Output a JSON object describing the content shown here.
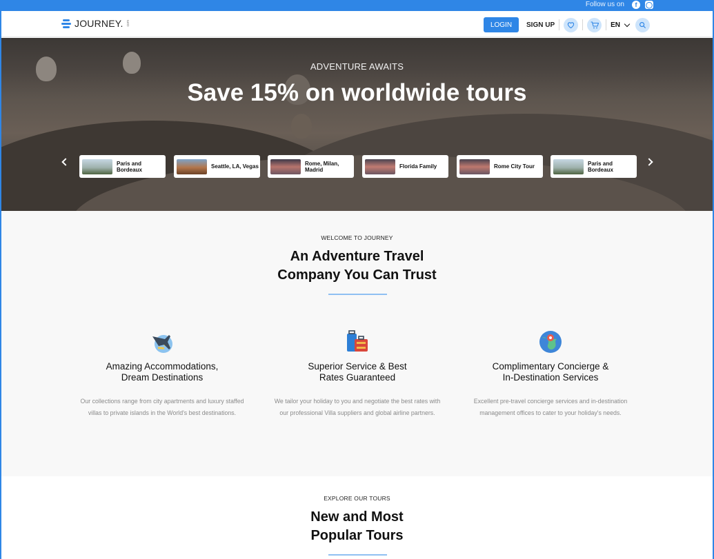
{
  "topbar": {
    "follow_text": "Follow us on",
    "social": [
      "facebook-icon",
      "instagram-icon"
    ]
  },
  "header": {
    "logo_text": "JOURNEY.",
    "logo_sub": "com",
    "login_label": "LOGIN",
    "signup_label": "SIGN UP",
    "language": "EN",
    "icons": [
      "heart-icon",
      "cart-icon",
      "search-icon"
    ]
  },
  "hero": {
    "kicker": "ADVENTURE AWAITS",
    "title": "Save 15% on worldwide tours",
    "cards": [
      {
        "label": "Paris and Bordeaux"
      },
      {
        "label": "Seattle, LA, Vegas"
      },
      {
        "label": "Rome, Milan, Madrid"
      },
      {
        "label": "Florida Family"
      },
      {
        "label": "Rome City Tour"
      },
      {
        "label": "Paris and Bordeaux"
      }
    ]
  },
  "welcome": {
    "kicker": "WELCOME TO JOURNEY",
    "title_line1": "An Adventure Travel",
    "title_line2": "Company You Can Trust",
    "features": [
      {
        "icon": "plane-globe-icon",
        "title_line1": "Amazing Accommodations,",
        "title_line2": "Dream Destinations",
        "desc": "Our collections range from city apartments and luxury staffed villas to private islands in the World's best destinations."
      },
      {
        "icon": "luggage-icon",
        "title_line1": "Superior Service & Best",
        "title_line2": "Rates Guaranteed",
        "desc": "We tailor your holiday to you and negotiate the best rates with our professional Villa suppliers and global airline partners."
      },
      {
        "icon": "globe-pin-icon",
        "title_line1": "Complimentary Concierge &",
        "title_line2": "In-Destination Services",
        "desc": "Excellent pre-travel concierge services and in-destination management offices to cater to your holiday's needs."
      }
    ]
  },
  "tours": {
    "kicker": "EXPLORE OUR TOURS",
    "title_line1": "New and Most",
    "title_line2": "Popular Tours"
  },
  "colors": {
    "accent": "#2f86e6",
    "accent_light": "#cde4fb",
    "section_bg": "#f8f8f8"
  }
}
